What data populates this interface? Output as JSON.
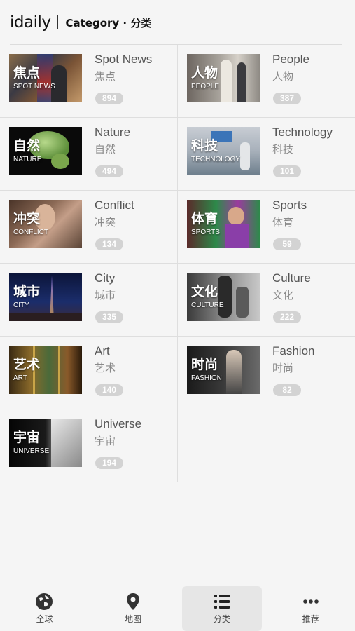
{
  "header": {
    "logo": "idaily",
    "title": "Category · 分类"
  },
  "categories": [
    {
      "en": "Spot News",
      "cn": "焦点",
      "thumb_cn": "焦点",
      "thumb_en": "SPOT NEWS",
      "count": "894"
    },
    {
      "en": "People",
      "cn": "人物",
      "thumb_cn": "人物",
      "thumb_en": "PEOPLE",
      "count": "387"
    },
    {
      "en": "Nature",
      "cn": "自然",
      "thumb_cn": "自然",
      "thumb_en": "NATURE",
      "count": "494"
    },
    {
      "en": "Technology",
      "cn": "科技",
      "thumb_cn": "科技",
      "thumb_en": "TECHNOLOGY",
      "count": "101"
    },
    {
      "en": "Conflict",
      "cn": "冲突",
      "thumb_cn": "冲突",
      "thumb_en": "CONFLICT",
      "count": "134"
    },
    {
      "en": "Sports",
      "cn": "体育",
      "thumb_cn": "体育",
      "thumb_en": "SPORTS",
      "count": "59"
    },
    {
      "en": "City",
      "cn": "城市",
      "thumb_cn": "城市",
      "thumb_en": "CITY",
      "count": "335"
    },
    {
      "en": "Culture",
      "cn": "文化",
      "thumb_cn": "文化",
      "thumb_en": "CULTURE",
      "count": "222"
    },
    {
      "en": "Art",
      "cn": "艺术",
      "thumb_cn": "艺术",
      "thumb_en": "ART",
      "count": "140"
    },
    {
      "en": "Fashion",
      "cn": "时尚",
      "thumb_cn": "时尚",
      "thumb_en": "FASHION",
      "count": "82"
    },
    {
      "en": "Universe",
      "cn": "宇宙",
      "thumb_cn": "宇宙",
      "thumb_en": "UNIVERSE",
      "count": "194"
    }
  ],
  "tabs": [
    {
      "label": "全球",
      "icon": "globe-icon"
    },
    {
      "label": "地图",
      "icon": "map-pin-icon"
    },
    {
      "label": "分类",
      "icon": "list-icon",
      "active": true
    },
    {
      "label": "推荐",
      "icon": "more-icon"
    }
  ]
}
